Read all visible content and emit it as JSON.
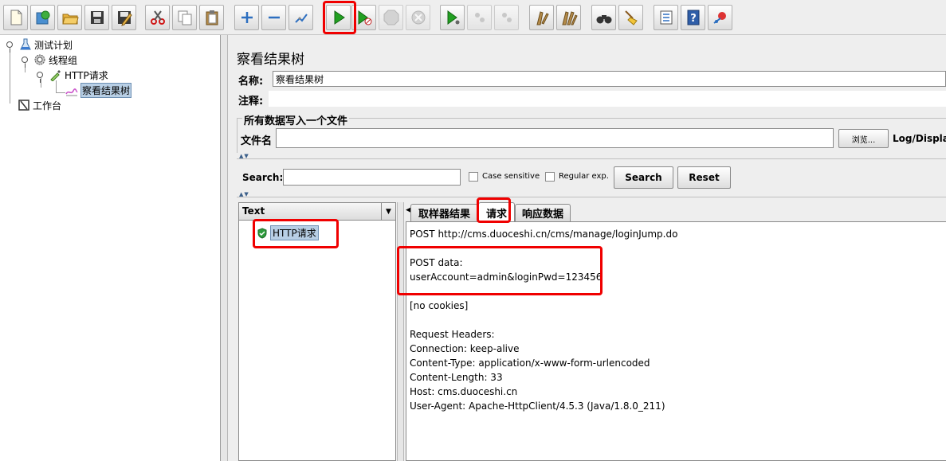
{
  "toolbar": {
    "buttons": [
      {
        "icon": "new-file-icon"
      },
      {
        "icon": "templates-icon"
      },
      {
        "icon": "open-folder-icon"
      },
      {
        "icon": "save-icon"
      },
      {
        "icon": "save-as-icon"
      },
      {
        "icon": "cut-icon"
      },
      {
        "icon": "copy-icon"
      },
      {
        "icon": "paste-icon"
      },
      {
        "icon": "expand-icon"
      },
      {
        "icon": "collapse-icon"
      },
      {
        "icon": "toggle-icon"
      },
      {
        "icon": "start-icon"
      },
      {
        "icon": "start-no-pause-icon"
      },
      {
        "icon": "stop-icon",
        "disabled": true
      },
      {
        "icon": "shutdown-icon",
        "disabled": true
      },
      {
        "icon": "remote-start-icon"
      },
      {
        "icon": "remote-stop-icon",
        "disabled": true
      },
      {
        "icon": "remote-shutdown-icon",
        "disabled": true
      },
      {
        "icon": "clear-icon"
      },
      {
        "icon": "clear-all-icon"
      },
      {
        "icon": "search-binoculars-icon"
      },
      {
        "icon": "reset-search-broom-icon"
      },
      {
        "icon": "function-helper-icon"
      },
      {
        "icon": "help-icon"
      },
      {
        "icon": "logger-icon"
      }
    ]
  },
  "tree": {
    "items": [
      {
        "label": "测试计划",
        "icon": "test-plan-icon"
      },
      {
        "label": "线程组",
        "icon": "thread-group-gear-icon"
      },
      {
        "label": "HTTP请求",
        "icon": "http-sampler-pipette-icon"
      },
      {
        "label": "察看结果树",
        "icon": "view-results-tree-icon"
      },
      {
        "label": "工作台",
        "icon": "workbench-icon"
      }
    ]
  },
  "panel": {
    "title": "察看结果树",
    "name_label": "名称:",
    "name_value": "察看结果树",
    "comment_label": "注释:",
    "comment_value": "",
    "file_group_title": "所有数据写入一个文件",
    "filename_label": "文件名",
    "filename_value": "",
    "browse_button": "浏览...",
    "log_display_label": "Log/Display"
  },
  "search": {
    "label": "Search:",
    "value": "",
    "case_sensitive_label": "Case sensitive",
    "regular_exp_label": "Regular exp.",
    "search_button": "Search",
    "reset_button": "Reset"
  },
  "results": {
    "renderer": "Text",
    "items": [
      {
        "label": "HTTP请求",
        "status": "success"
      }
    ]
  },
  "tabs": [
    {
      "label": "取样器结果",
      "active": false
    },
    {
      "label": "请求",
      "active": true
    },
    {
      "label": "响应数据",
      "active": false
    }
  ],
  "request": {
    "lines": [
      "POST http://cms.duoceshi.cn/cms/manage/loginJump.do",
      "",
      "POST data:",
      "userAccount=admin&loginPwd=123456",
      "",
      "[no cookies]",
      "",
      "Request Headers:",
      "Connection: keep-alive",
      "Content-Type: application/x-www-form-urlencoded",
      "Content-Length: 33",
      "Host: cms.duoceshi.cn",
      "User-Agent: Apache-HttpClient/4.5.3 (Java/1.8.0_211)"
    ]
  },
  "colors": {
    "highlight_box": "#f00000",
    "selection_bg": "#b8cfe5",
    "success_green": "#2e9b3c"
  }
}
